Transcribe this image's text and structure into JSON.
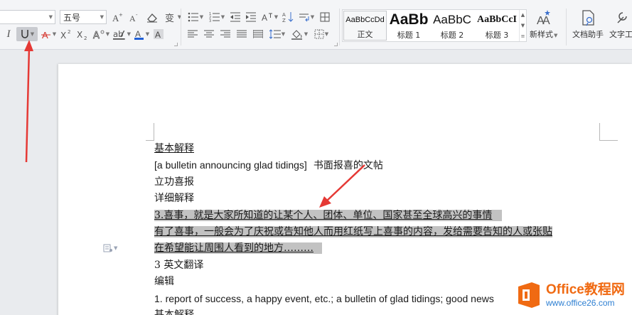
{
  "ribbon": {
    "font_size_value": "五号",
    "styles": [
      {
        "sample": "AaBbCcDd",
        "label": "正文"
      },
      {
        "sample": "AaBb",
        "label": "标题 1"
      },
      {
        "sample": "AaBbC",
        "label": "标题 2"
      },
      {
        "sample": "AaBbCcI",
        "label": "标题 3"
      }
    ],
    "new_style_label": "新样式",
    "doc_assistant_label": "文档助手",
    "text_tools_label": "文字工"
  },
  "document": {
    "lines": [
      "基本解释",
      "[a bulletin announcing glad tidings]",
      "书面报喜的文帖",
      "立功喜报",
      "详细解释",
      "3.喜事，就是大家所知道的让某个人、团体、单位、国家甚至全球高兴的事情",
      "有了喜事，一般会为了庆祝或告知他人而用红纸写上喜事的内容，发给需要告知的人或张贴",
      "在希望能让周围人看到的地方………",
      "3 英文翻译",
      "编辑",
      "1. report of success, a happy event, etc.; a bulletin of glad tidings; good news",
      "基本解释"
    ]
  },
  "watermark": {
    "title": "Office教程网",
    "url": "www.office26.com"
  },
  "colors": {
    "arrow": "#e53935",
    "selection": "#c2c2c2",
    "font_color_blue": "#1f5fd6",
    "watermark_orange": "#f06a12",
    "watermark_blue": "#2d7fd2"
  }
}
